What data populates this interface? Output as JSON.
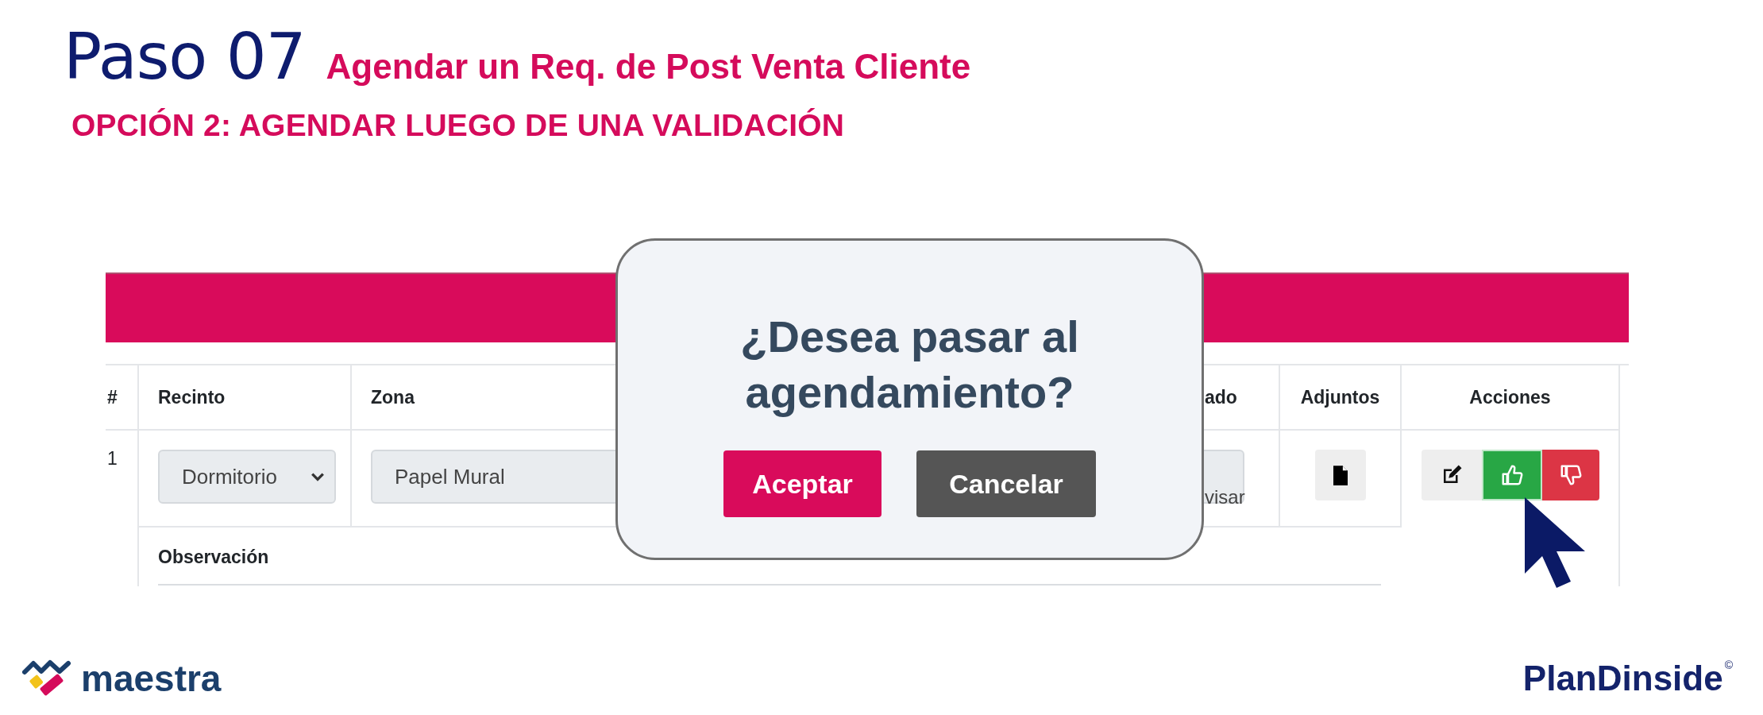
{
  "slide": {
    "step": "Paso 07",
    "subtitle": "Agendar un Req. de Post Venta Cliente",
    "heading": "OPCIÓN 2: AGENDAR LUEGO DE UNA VALIDACIÓN"
  },
  "table": {
    "columns": [
      "#",
      "Recinto",
      "Zona",
      "ado",
      "Adjuntos",
      "Acciones"
    ],
    "rows": [
      {
        "number": "1",
        "recinto": "Dormitorio",
        "zona": "Papel Mural",
        "column_4": "visar",
        "observation_label": "Observación",
        "actions": [
          {
            "kind": "edit"
          },
          {
            "kind": "approve"
          },
          {
            "kind": "reject"
          }
        ]
      }
    ]
  },
  "dialog": {
    "title": "¿Desea pasar al agendamiento?",
    "buttons": [
      {
        "label": "Aceptar",
        "kind": "primary"
      },
      {
        "label": "Cancelar",
        "kind": "secondary"
      }
    ]
  },
  "footer": {
    "left_logo": "maestra",
    "right_logo": "PlanDinside",
    "right_logo_mark": "©"
  }
}
